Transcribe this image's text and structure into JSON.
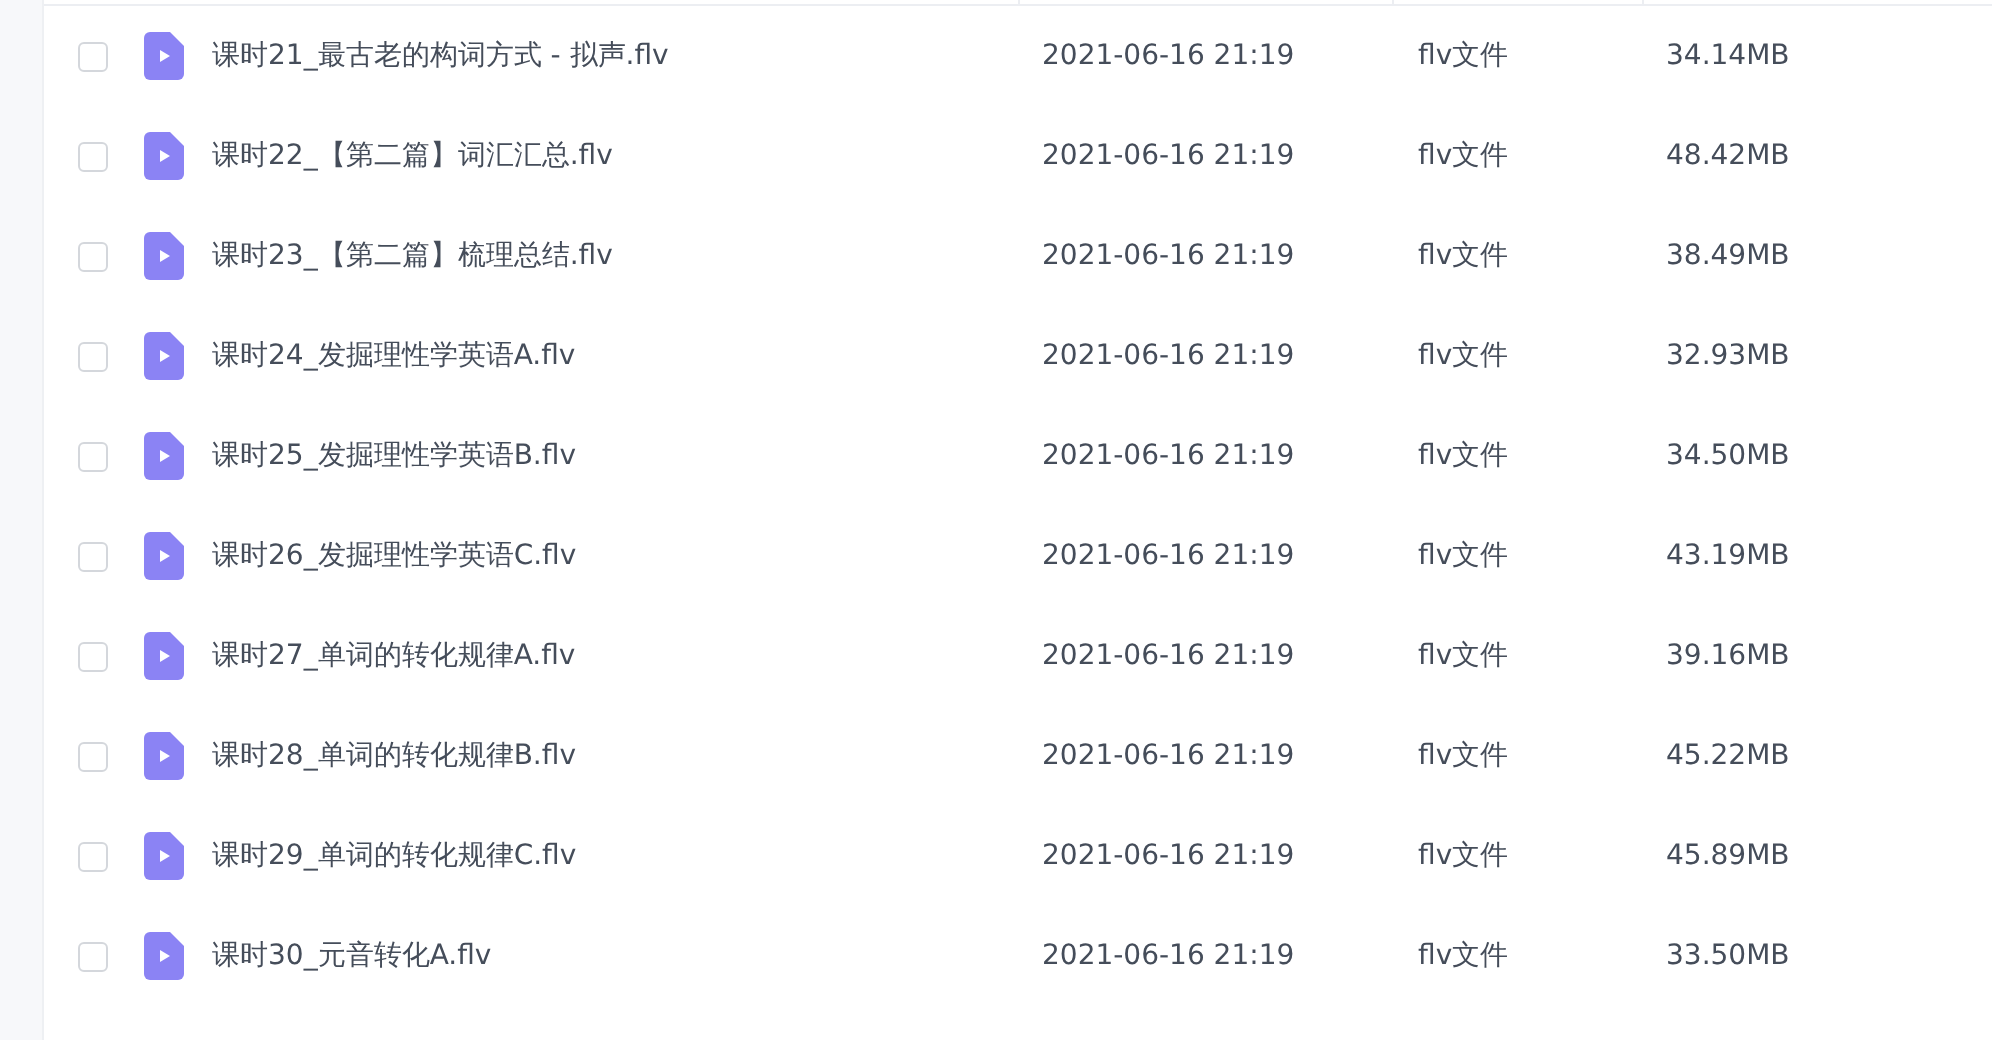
{
  "files": [
    {
      "name": "课时21_最古老的构词方式 - 拟声.flv",
      "date": "2021-06-16 21:19",
      "type": "flv文件",
      "size": "34.14MB",
      "checked": false
    },
    {
      "name": "课时22_【第二篇】词汇汇总.flv",
      "date": "2021-06-16 21:19",
      "type": "flv文件",
      "size": "48.42MB",
      "checked": false
    },
    {
      "name": "课时23_【第二篇】梳理总结.flv",
      "date": "2021-06-16 21:19",
      "type": "flv文件",
      "size": "38.49MB",
      "checked": false
    },
    {
      "name": "课时24_发掘理性学英语A.flv",
      "date": "2021-06-16 21:19",
      "type": "flv文件",
      "size": "32.93MB",
      "checked": false
    },
    {
      "name": "课时25_发掘理性学英语B.flv",
      "date": "2021-06-16 21:19",
      "type": "flv文件",
      "size": "34.50MB",
      "checked": false
    },
    {
      "name": "课时26_发掘理性学英语C.flv",
      "date": "2021-06-16 21:19",
      "type": "flv文件",
      "size": "43.19MB",
      "checked": false
    },
    {
      "name": "课时27_单词的转化规律A.flv",
      "date": "2021-06-16 21:19",
      "type": "flv文件",
      "size": "39.16MB",
      "checked": false
    },
    {
      "name": "课时28_单词的转化规律B.flv",
      "date": "2021-06-16 21:19",
      "type": "flv文件",
      "size": "45.22MB",
      "checked": false
    },
    {
      "name": "课时29_单词的转化规律C.flv",
      "date": "2021-06-16 21:19",
      "type": "flv文件",
      "size": "45.89MB",
      "checked": false
    },
    {
      "name": "课时30_元音转化A.flv",
      "date": "2021-06-16 21:19",
      "type": "flv文件",
      "size": "33.50MB",
      "checked": false
    }
  ]
}
